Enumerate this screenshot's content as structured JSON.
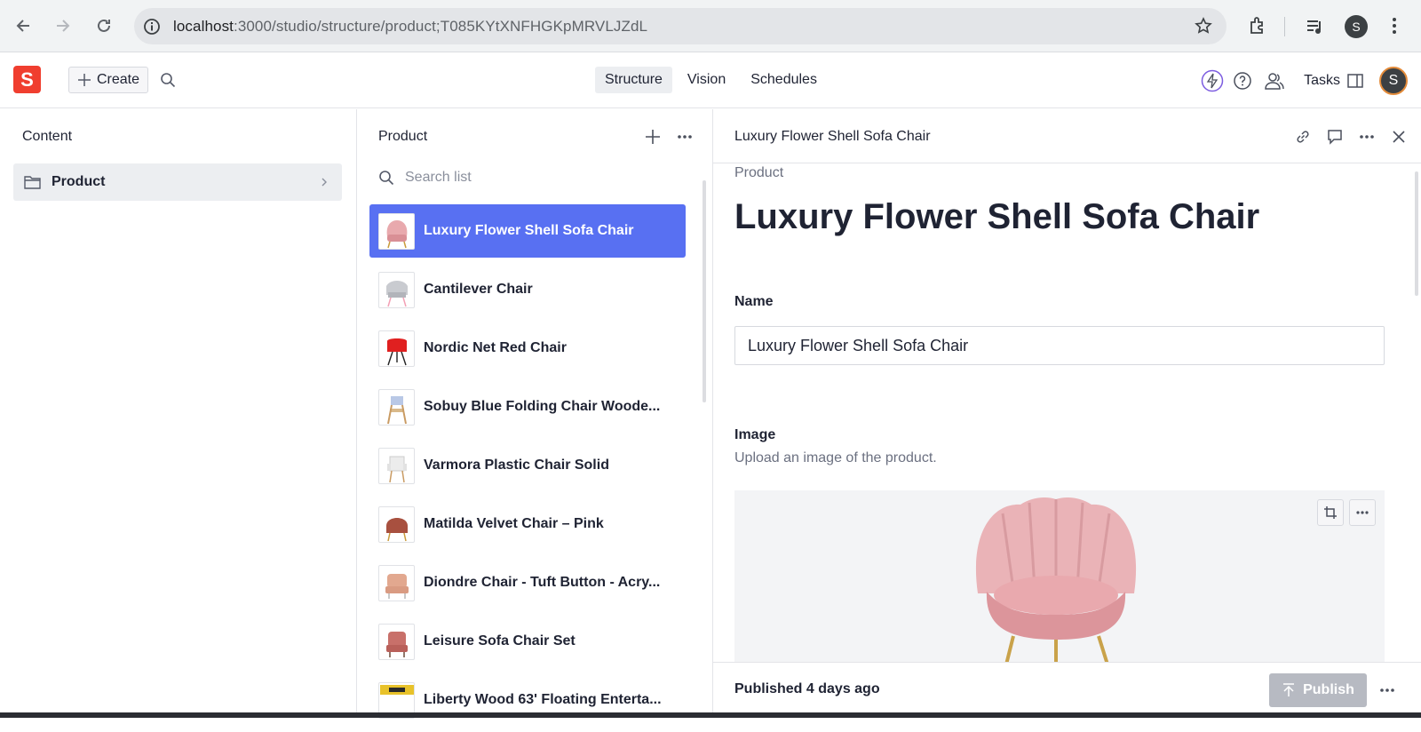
{
  "browser": {
    "url_host": "localhost",
    "url_path": ":3000/studio/structure/product;T085KYtXNFHGKpMRVLJZdL",
    "profile_initial": "S"
  },
  "app": {
    "logo_letter": "S",
    "create_label": "Create",
    "tabs": [
      {
        "label": "Structure",
        "active": true
      },
      {
        "label": "Vision",
        "active": false
      },
      {
        "label": "Schedules",
        "active": false
      }
    ],
    "tasks_label": "Tasks",
    "user_initial": "S"
  },
  "content_pane": {
    "title": "Content",
    "items": [
      {
        "label": "Product"
      }
    ]
  },
  "list_pane": {
    "title": "Product",
    "search_placeholder": "Search list",
    "items": [
      {
        "label": "Luxury Flower Shell Sofa Chair",
        "selected": true,
        "thumb_color": "#e8a9ad"
      },
      {
        "label": "Cantilever Chair",
        "selected": false,
        "thumb_color": "#c9cbd0"
      },
      {
        "label": "Nordic Net Red Chair",
        "selected": false,
        "thumb_color": "#e02020"
      },
      {
        "label": "Sobuy Blue Folding Chair Woode...",
        "selected": false,
        "thumb_color": "#b9c8e6"
      },
      {
        "label": "Varmora Plastic Chair Solid",
        "selected": false,
        "thumb_color": "#e9e9e9"
      },
      {
        "label": "Matilda Velvet Chair – Pink",
        "selected": false,
        "thumb_color": "#a8503f"
      },
      {
        "label": "Diondre Chair - Tuft Button - Acry...",
        "selected": false,
        "thumb_color": "#e2a88f"
      },
      {
        "label": "Leisure Sofa Chair Set",
        "selected": false,
        "thumb_color": "#c8706a"
      },
      {
        "label": "Liberty Wood 63' Floating Enterta...",
        "selected": false,
        "thumb_color": "#e8c22a"
      }
    ]
  },
  "document": {
    "header_title": "Luxury Flower Shell Sofa Chair",
    "breadcrumb": "Product",
    "title": "Luxury Flower Shell Sofa Chair",
    "name_label": "Name",
    "name_value": "Luxury Flower Shell Sofa Chair",
    "image_label": "Image",
    "image_description": "Upload an image of the product.",
    "status": "Published 4 days ago",
    "publish_label": "Publish"
  },
  "colors": {
    "accent": "#5870f2",
    "logo": "#f03e2f"
  }
}
